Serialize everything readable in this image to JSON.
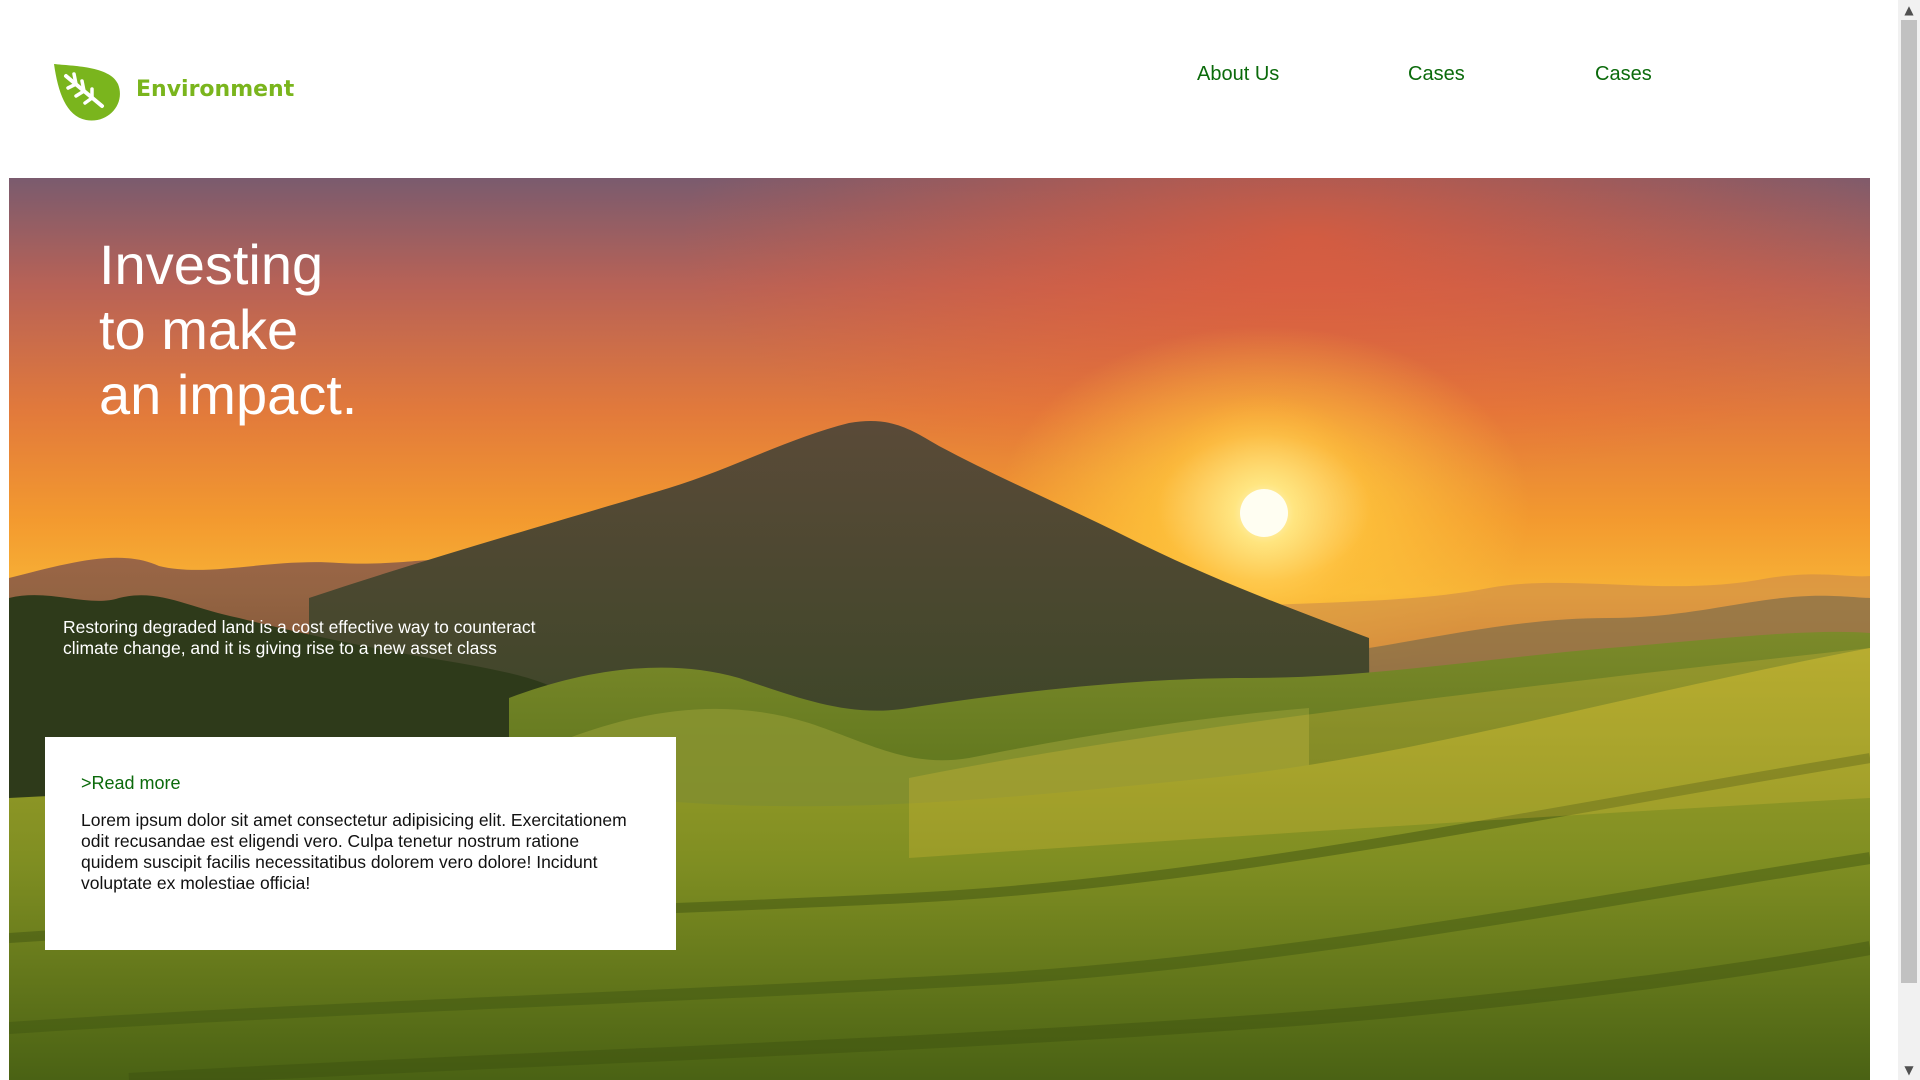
{
  "header": {
    "brand": "Environment",
    "logo_icon": "leaf-icon",
    "nav": [
      {
        "label": "About Us"
      },
      {
        "label": "Cases"
      },
      {
        "label": "Cases"
      }
    ]
  },
  "hero": {
    "title_lines": [
      "Investing",
      "to make",
      "an impact."
    ],
    "subtitle": "Restoring degraded land is a cost effective way to counteract climate change, and it is giving rise to a new asset class",
    "image": "sunset-over-tea-plantation-hills"
  },
  "card": {
    "link": ">Read more",
    "body": "Lorem ipsum dolor sit amet consectetur adipisicing elit. Exercitationem odit recusandae est eligendi vero. Culpa tenetur nostrum ratione quidem suscipit facilis necessitatibus dolorem vero dolore! Incidunt voluptate ex molestiae officia!"
  },
  "colors": {
    "brand_green": "#7ab51d",
    "nav_green": "#0b6a0b",
    "hero_text": "#ffffff"
  },
  "scrollbar": {
    "up_icon": "scroll-up-arrow-icon",
    "down_icon": "scroll-down-arrow-icon"
  }
}
